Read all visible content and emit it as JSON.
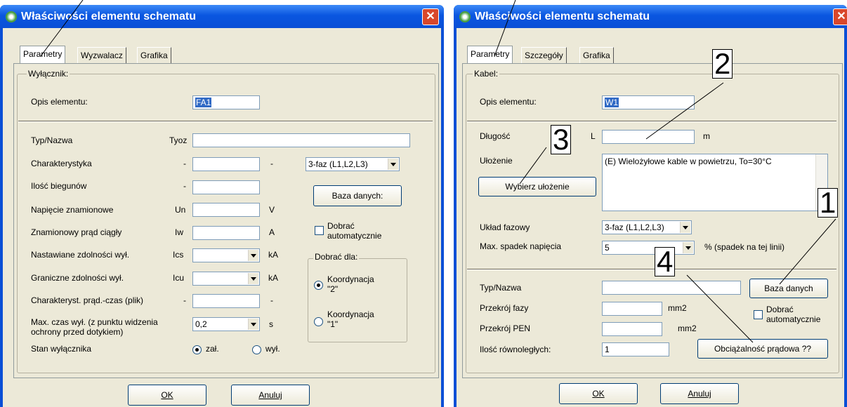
{
  "left": {
    "title": "Właściwości elementu schematu",
    "close": "✕",
    "tabs": [
      "Parametry",
      "Wyzwalacz",
      "Grafika"
    ],
    "group_label": "Wyłącznik:",
    "opis_label": "Opis elementu:",
    "opis_value": "FA1",
    "rows": [
      {
        "label": "Typ/Nazwa",
        "symbol": "Tyoz",
        "unit": ""
      },
      {
        "label": "Charakterystyka",
        "symbol": "-",
        "unit": "-"
      },
      {
        "label": "Ilość biegunów",
        "symbol": "-",
        "unit": ""
      },
      {
        "label": "Napięcie znamionowe",
        "symbol": "Un",
        "unit": "V"
      },
      {
        "label": "Znamionowy prąd ciągły",
        "symbol": "Iw",
        "unit": "A"
      },
      {
        "label": "Nastawiane zdolności wył.",
        "symbol": "Ics",
        "unit": "kA"
      },
      {
        "label": "Graniczne zdolności wył.",
        "symbol": "Icu",
        "unit": "kA"
      },
      {
        "label": "Charakteryst. prąd.-czas (plik)",
        "symbol": "-",
        "unit": "-"
      },
      {
        "label": "Max. czas wył. (z punktu widzenia ochrony przed dotykiem)",
        "symbol": "",
        "unit": "s"
      }
    ],
    "czas_value": "0,2",
    "faz_value": "3-faz (L1,L2,L3)",
    "baza_button": "Baza danych:",
    "dobrac_label": "Dobrać automatycznie",
    "dobrac_dla_label": "Dobrać dla:",
    "koord2": "Koordynacja \"2\"",
    "koord1": "Koordynacja \"1\"",
    "stan_label": "Stan wyłącznika",
    "zal_label": "zał.",
    "wyl_label": "wył.",
    "ok_label": "OK",
    "anuluj_label": "Anuluj"
  },
  "right": {
    "title": "Właściwości elementu schematu",
    "close": "✕",
    "tabs": [
      "Parametry",
      "Szczegóły",
      "Grafika"
    ],
    "group_label": "Kabel:",
    "opis_label": "Opis elementu:",
    "opis_value": "W1",
    "dlugosc_label": "Długość",
    "dlugosc_symbol": "L",
    "dlugosc_unit": "m",
    "ulozenie_label": "Ułożenie",
    "ulozenie_value": "(E) Wielożyłowe kable w powietrzu, To=30°C",
    "wybierz_button": "Wybierz ułożenie",
    "uklad_label": "Układ fazowy",
    "uklad_value": "3-faz (L1,L2,L3)",
    "spadek_label": "Max. spadek napięcia",
    "spadek_value": "5",
    "spadek_unit": "%  (spadek na tej linii)",
    "typ_label": "Typ/Nazwa",
    "baza_button": "Baza danych",
    "przekroj_fazy_label": "Przekrój fazy",
    "przekroj_pen_label": "Przekrój PEN",
    "mm2": "mm2",
    "dobrac_label": "Dobrać automatycznie",
    "ilosc_label": "Ilość równoległych:",
    "ilosc_value": "1",
    "obciaz_button": "Obciążalność prądowa ??",
    "ok_label": "OK",
    "anuluj_label": "Anuluj"
  },
  "callouts": [
    "2",
    "3",
    "1",
    "4"
  ]
}
